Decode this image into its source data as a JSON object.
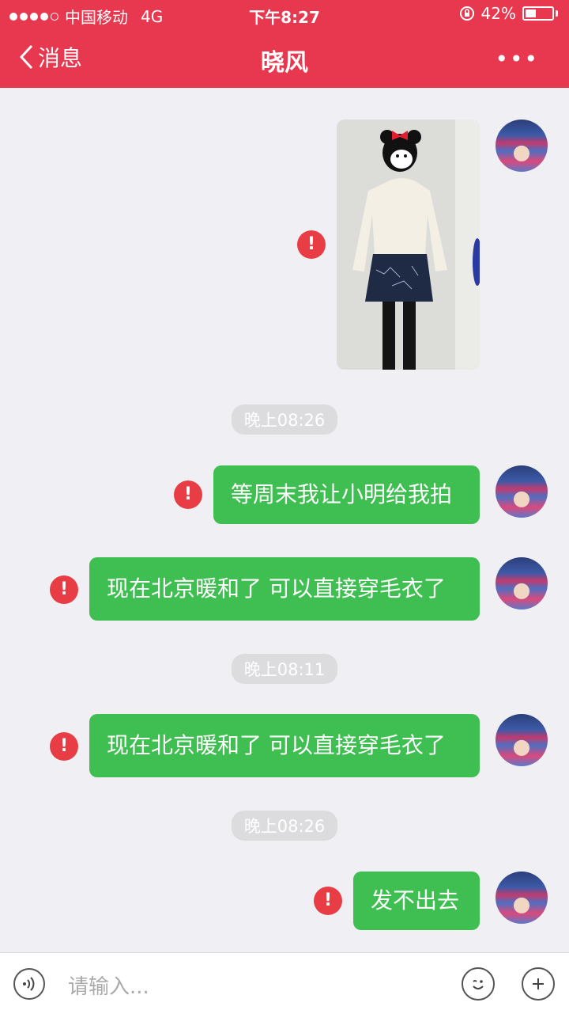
{
  "status": {
    "carrier": "中国移动",
    "network": "4G",
    "time": "下午8:27",
    "battery": "42%",
    "battery_level": 0.42
  },
  "nav": {
    "back_label": "消息",
    "title": "晓风",
    "more_label": "•••"
  },
  "messages": [
    {
      "type": "image",
      "failed": true
    },
    {
      "type": "timestamp",
      "text": "晚上08:26"
    },
    {
      "type": "text",
      "text": "等周末我让小明给我拍",
      "failed": true
    },
    {
      "type": "text",
      "text": "现在北京暖和了 可以直接穿毛衣了",
      "failed": true
    },
    {
      "type": "timestamp",
      "text": "晚上08:11"
    },
    {
      "type": "text",
      "text": "现在北京暖和了 可以直接穿毛衣了",
      "failed": true
    },
    {
      "type": "timestamp",
      "text": "晚上08:26"
    },
    {
      "type": "text",
      "text": "发不出去",
      "failed": true
    }
  ],
  "input": {
    "placeholder": "请输入..."
  },
  "icons": {
    "voice": "voice-icon",
    "emoji": "emoji-icon",
    "add": "plus-icon",
    "error": "exclamation-icon"
  },
  "colors": {
    "header": "#e8384f",
    "bubble": "#3fbf51",
    "error": "#e83d45"
  }
}
